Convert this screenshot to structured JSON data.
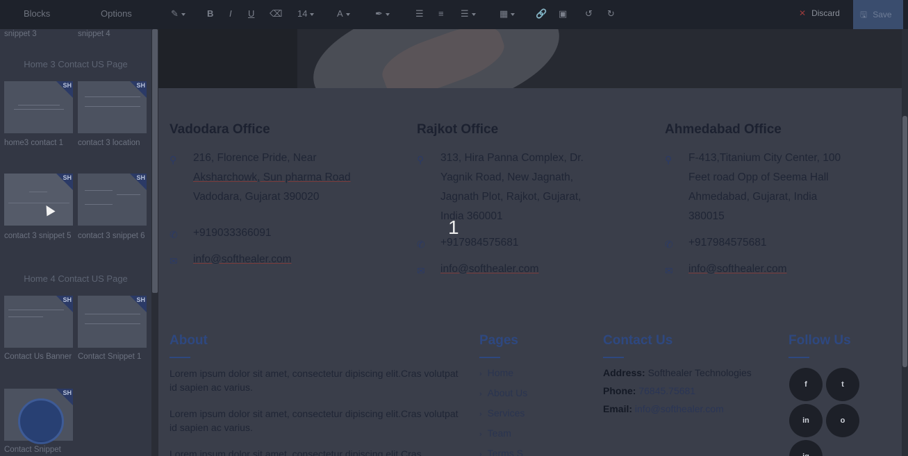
{
  "toolbar": {
    "tabs": [
      {
        "label": "Blocks"
      },
      {
        "label": "Options"
      }
    ],
    "font_size": "14",
    "discard_label": "Discard",
    "save_label": "Save"
  },
  "sidebar": {
    "top_captions": [
      "snippet 3",
      "snippet 4"
    ],
    "sections": [
      {
        "heading": "Home 3 Contact US Page",
        "items": [
          {
            "label": "home3 contact 1"
          },
          {
            "label": "contact 3 location"
          },
          {
            "label": "contact 3 snippet 5"
          },
          {
            "label": "contact 3 snippet 6"
          }
        ]
      },
      {
        "heading": "Home 4 Contact US Page",
        "items": [
          {
            "label": "Contact Us Banner"
          },
          {
            "label": "Contact Snippet 1"
          },
          {
            "label": "Contact Snippet"
          }
        ]
      }
    ],
    "badge": "SH"
  },
  "offices": [
    {
      "title": "Vadodara Office",
      "address": [
        "216, Florence Pride, Near",
        "Aksharchowk, Sun pharma Road",
        "Vadodara, Gujarat 390020"
      ],
      "phone": "+919033366091",
      "email": "info@softhealer.com"
    },
    {
      "title": "Rajkot Office",
      "address": [
        "313, Hira Panna Complex, Dr.",
        "Yagnik Road, New Jagnath,",
        "Jagnath Plot, Rajkot, Gujarat,",
        "India 360001"
      ],
      "phone": "+917984575681",
      "email": "info@softhealer.com"
    },
    {
      "title": "Ahmedabad Office",
      "address": [
        "F-413,Titanium City Center, 100",
        "Feet road Opp of Seema Hall",
        "Ahmedabad, Gujarat, India",
        "380015"
      ],
      "phone": "+917984575681",
      "email": "info@softhealer.com"
    }
  ],
  "step_number": "1",
  "footer": {
    "about": {
      "heading": "About",
      "paragraphs": [
        "Lorem ipsum dolor sit amet, consectetur dipiscing elit.Cras volutpat id sapien ac varius.",
        "Lorem ipsum dolor sit amet, consectetur dipiscing elit.Cras volutpat id sapien ac varius.",
        "Lorem ipsum dolor sit amet, consectetur dipiscing elit.Cras"
      ]
    },
    "pages": {
      "heading": "Pages",
      "links": [
        "Home",
        "About Us",
        "Services",
        "Team",
        "Terms S"
      ]
    },
    "contact": {
      "heading": "Contact Us",
      "address_label": "Address:",
      "address_value": "Softhealer Technologies",
      "phone_label": "Phone:",
      "phone_value": "76845.75681",
      "email_label": "Email:",
      "email_value": "info@softhealer.com"
    },
    "follow": {
      "heading": "Follow Us",
      "socials": [
        "f",
        "t",
        "in",
        "o",
        "ig"
      ]
    }
  },
  "colors": {
    "accent": "#2e4880",
    "toolbar_bg": "#1e222b",
    "sidebar_bg": "#333744"
  }
}
